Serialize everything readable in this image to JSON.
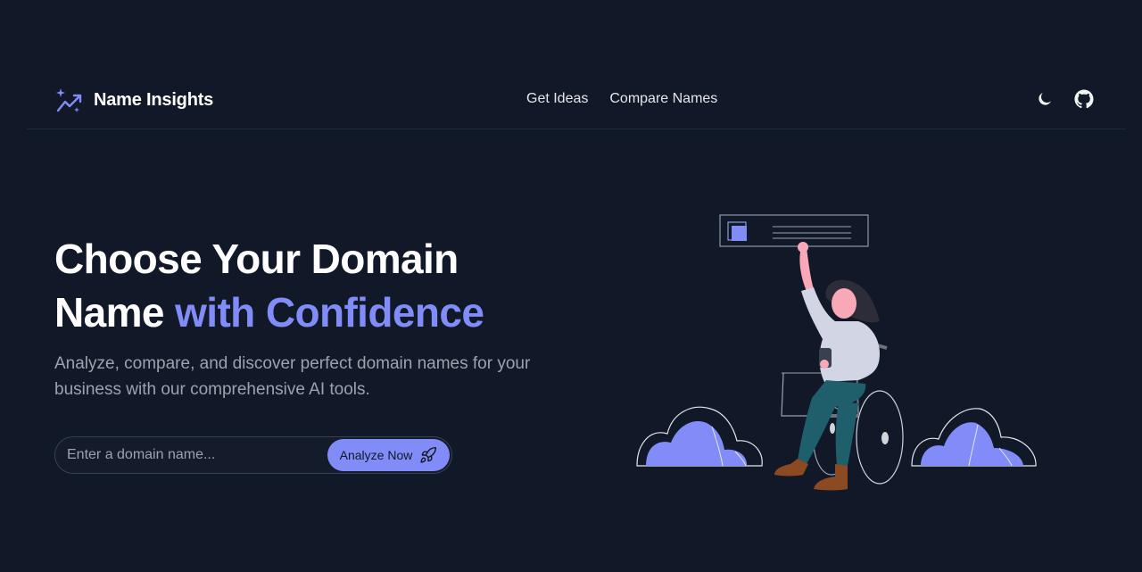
{
  "header": {
    "brand": "Name Insights",
    "nav": [
      {
        "label": "Get Ideas"
      },
      {
        "label": "Compare Names"
      }
    ],
    "actions": {
      "theme_icon": "moon-icon",
      "repo_icon": "github-icon"
    }
  },
  "hero": {
    "title_main": "Choose Your Domain Name ",
    "title_accent": "with Confidence",
    "subtitle": "Analyze, compare, and discover perfect domain names for your business with our comprehensive AI tools."
  },
  "search": {
    "placeholder": "Enter a domain name...",
    "value": "",
    "button_label": "Analyze Now",
    "button_icon": "rocket-icon"
  },
  "colors": {
    "background": "#111827",
    "accent": "#818cf8",
    "muted_text": "#9ca3af",
    "border": "#374151"
  }
}
